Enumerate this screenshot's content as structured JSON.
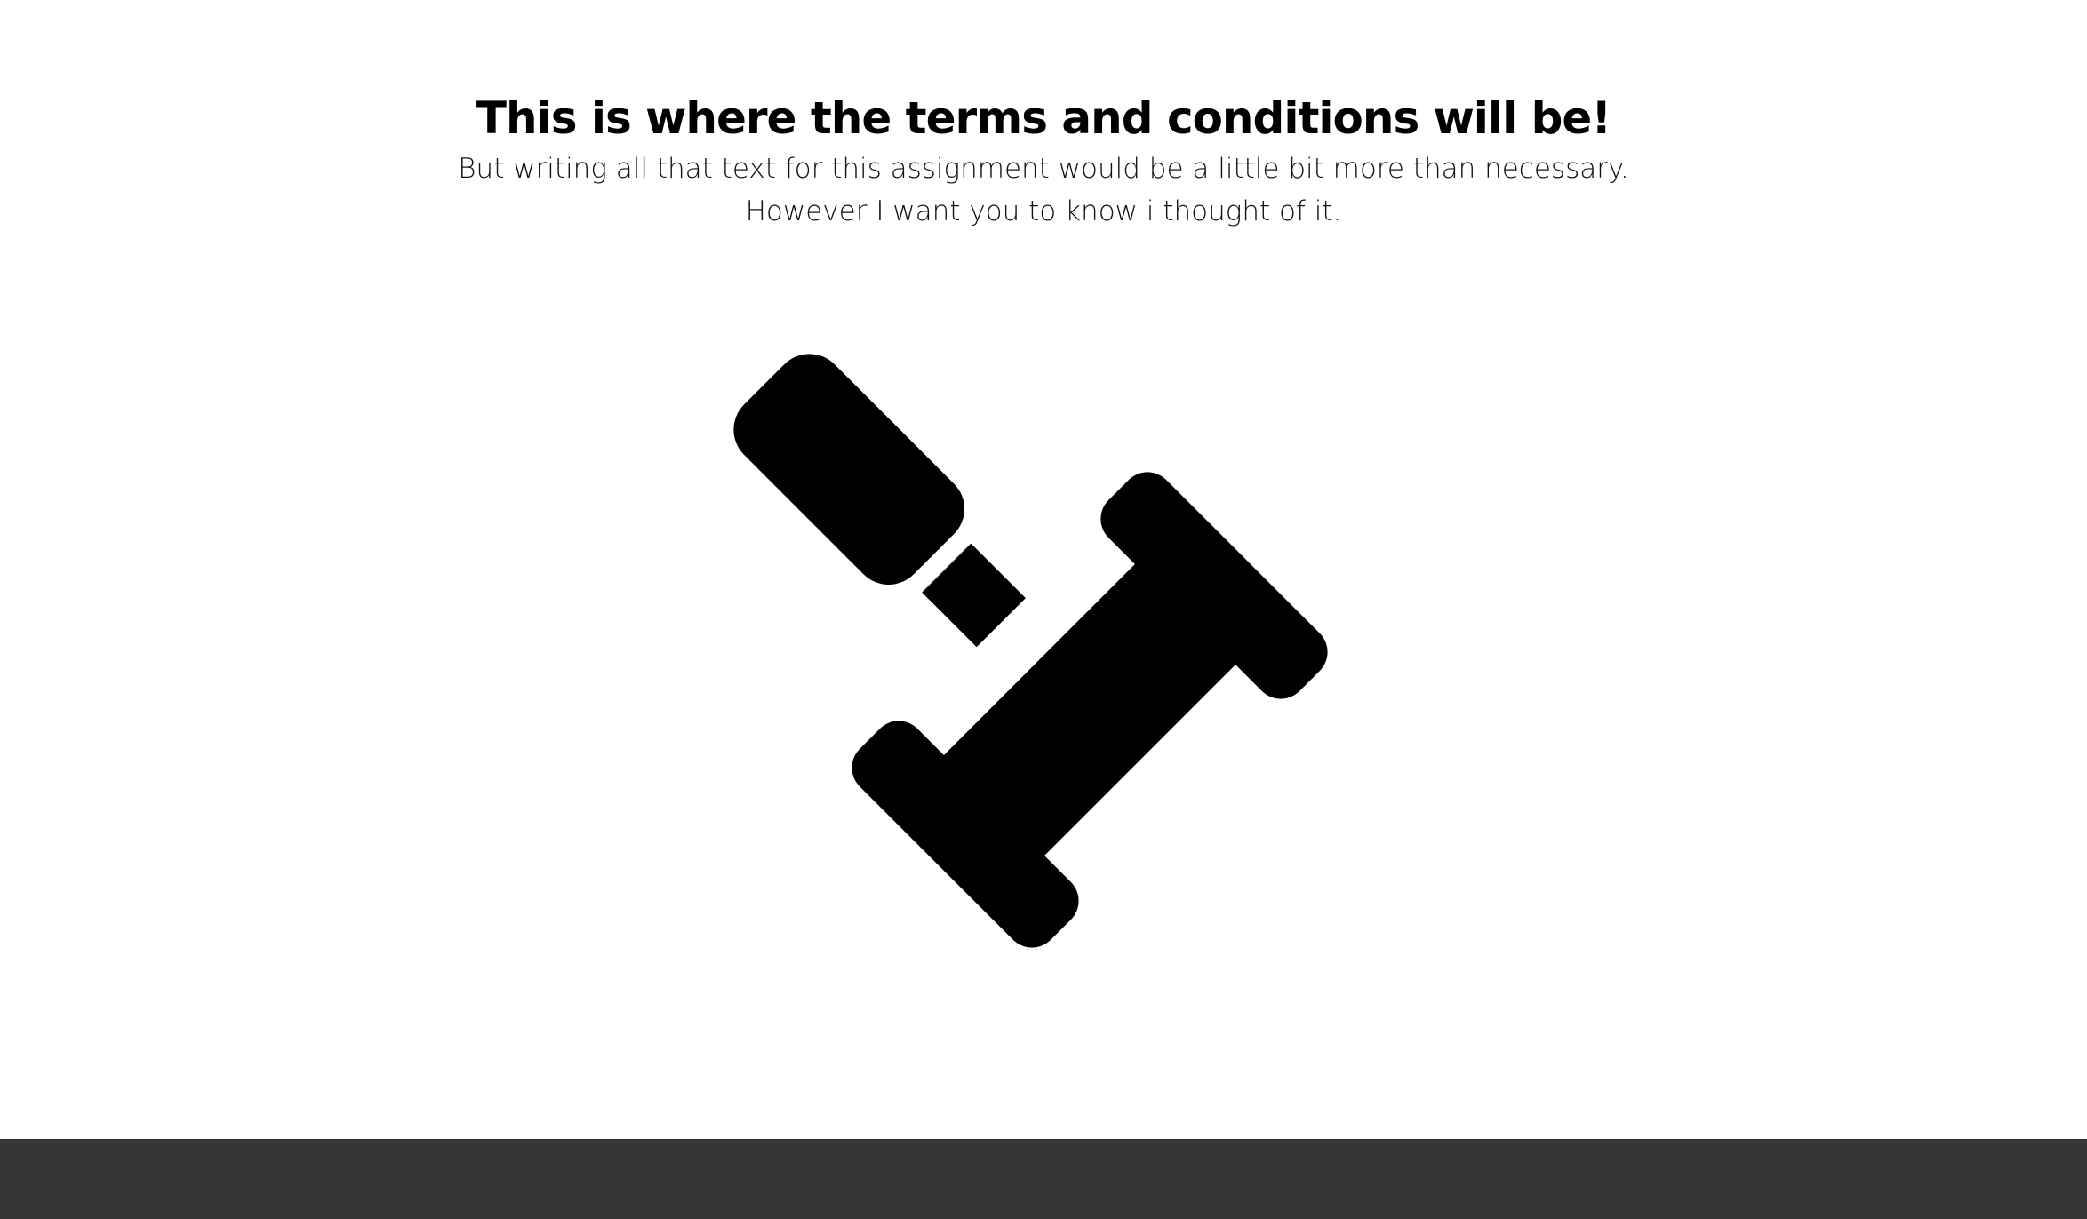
{
  "terms": {
    "title": "This is where the terms and conditions will be!",
    "line1": "But writing all that text for this assignment would be a little bit more than necessary.",
    "line2": "However I want you to know i thought of it."
  },
  "illustration": {
    "icon": "gavel-icon",
    "color": "#000000"
  },
  "footer": {
    "background": "#353638"
  }
}
